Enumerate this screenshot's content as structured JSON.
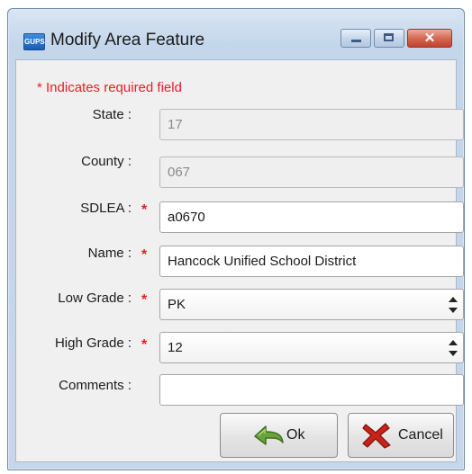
{
  "window": {
    "title": "Modify Area Feature",
    "icon_text": "GUPS"
  },
  "form": {
    "required_note": "* Indicates required field",
    "state": {
      "label": "State :",
      "value": "17",
      "required": false
    },
    "county": {
      "label": "County :",
      "value": "067",
      "required": false
    },
    "sdlea": {
      "label": "SDLEA :",
      "value": "a0670",
      "required": true
    },
    "name": {
      "label": "Name :",
      "value": "Hancock Unified School District",
      "required": true
    },
    "low_grade": {
      "label": "Low Grade :",
      "value": "PK",
      "required": true
    },
    "high_grade": {
      "label": "High Grade :",
      "value": "12",
      "required": true
    },
    "comments": {
      "label": "Comments :",
      "value": "",
      "required": false
    },
    "required_mark": "*"
  },
  "buttons": {
    "ok_label": "Ok",
    "cancel_label": "Cancel"
  },
  "colors": {
    "required": "#e81e1e",
    "window_frame": "#c4d6ea",
    "client": "#f0f0f0"
  }
}
